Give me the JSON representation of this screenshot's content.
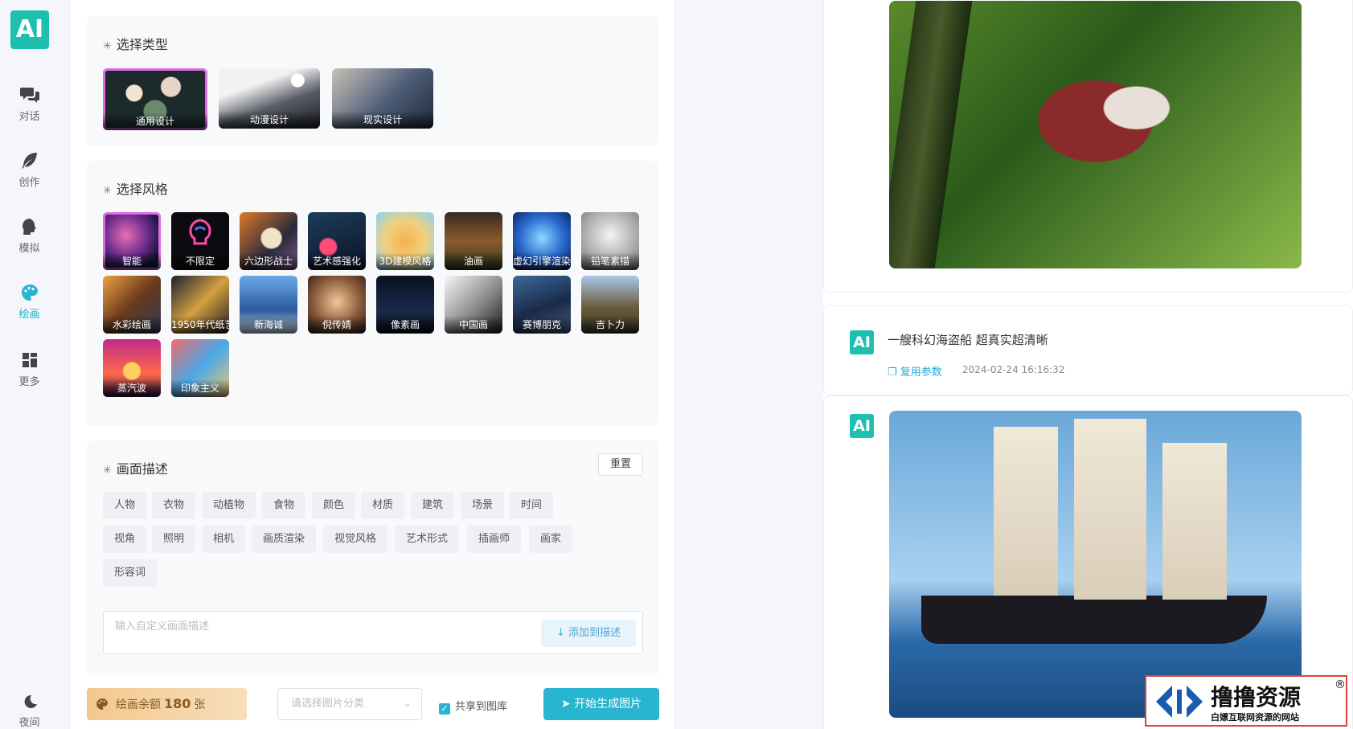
{
  "app": {
    "logo": "AI"
  },
  "sidebar": {
    "items": [
      {
        "label": "对话",
        "icon": "chat-icon"
      },
      {
        "label": "创作",
        "icon": "feather-icon"
      },
      {
        "label": "模拟",
        "icon": "head-icon"
      },
      {
        "label": "绘画",
        "icon": "palette-icon",
        "active": true
      },
      {
        "label": "更多",
        "icon": "grid-icon"
      }
    ],
    "night": {
      "label": "夜间",
      "icon": "moon-icon"
    }
  },
  "type_section": {
    "title": "选择类型",
    "items": [
      {
        "label": "通用设计",
        "selected": true
      },
      {
        "label": "动漫设计"
      },
      {
        "label": "现实设计"
      }
    ]
  },
  "style_section": {
    "title": "选择风格",
    "items": [
      {
        "label": "智能",
        "selected": true
      },
      {
        "label": "不限定"
      },
      {
        "label": "六边形战士"
      },
      {
        "label": "艺术感强化"
      },
      {
        "label": "3D建模风格"
      },
      {
        "label": "油画"
      },
      {
        "label": "虚幻引擎渲染"
      },
      {
        "label": "铅笔素描"
      },
      {
        "label": "水彩绘画"
      },
      {
        "label": "1950年代纸艺"
      },
      {
        "label": "新海诚"
      },
      {
        "label": "倪传婧"
      },
      {
        "label": "像素画"
      },
      {
        "label": "中国画"
      },
      {
        "label": "赛博朋克"
      },
      {
        "label": "吉卜力"
      },
      {
        "label": "蒸汽波"
      },
      {
        "label": "印象主义"
      }
    ]
  },
  "desc_section": {
    "title": "画面描述",
    "reset_label": "重置",
    "tags": [
      "人物",
      "衣物",
      "动植物",
      "食物",
      "颜色",
      "材质",
      "建筑",
      "场景",
      "时间",
      "视角",
      "照明",
      "相机",
      "画质渲染",
      "视觉风格",
      "艺术形式",
      "插画师",
      "画家",
      "形容词"
    ],
    "input_placeholder": "输入自定义画面描述",
    "add_label": "添加到描述"
  },
  "footer": {
    "quota_prefix": "绘画余额",
    "quota_value": "180",
    "quota_unit": "张",
    "category_placeholder": "请选择图片分类",
    "share_label": "共享到图库",
    "share_checked": true,
    "generate_label": "开始生成图片"
  },
  "feed": {
    "badge": "AI",
    "prompt": "一艘科幻海盗船 超真实超清晰",
    "reuse_label": "复用参数",
    "timestamp": "2024-02-24 16:16:32"
  },
  "watermark": {
    "title": "撸撸资源",
    "subtitle": "白嫖互联网资源的网站",
    "mark": "®"
  },
  "colors": {
    "accent": "#27b5d0",
    "logo": "#1fbfb0",
    "select_border": "#e069e6"
  }
}
